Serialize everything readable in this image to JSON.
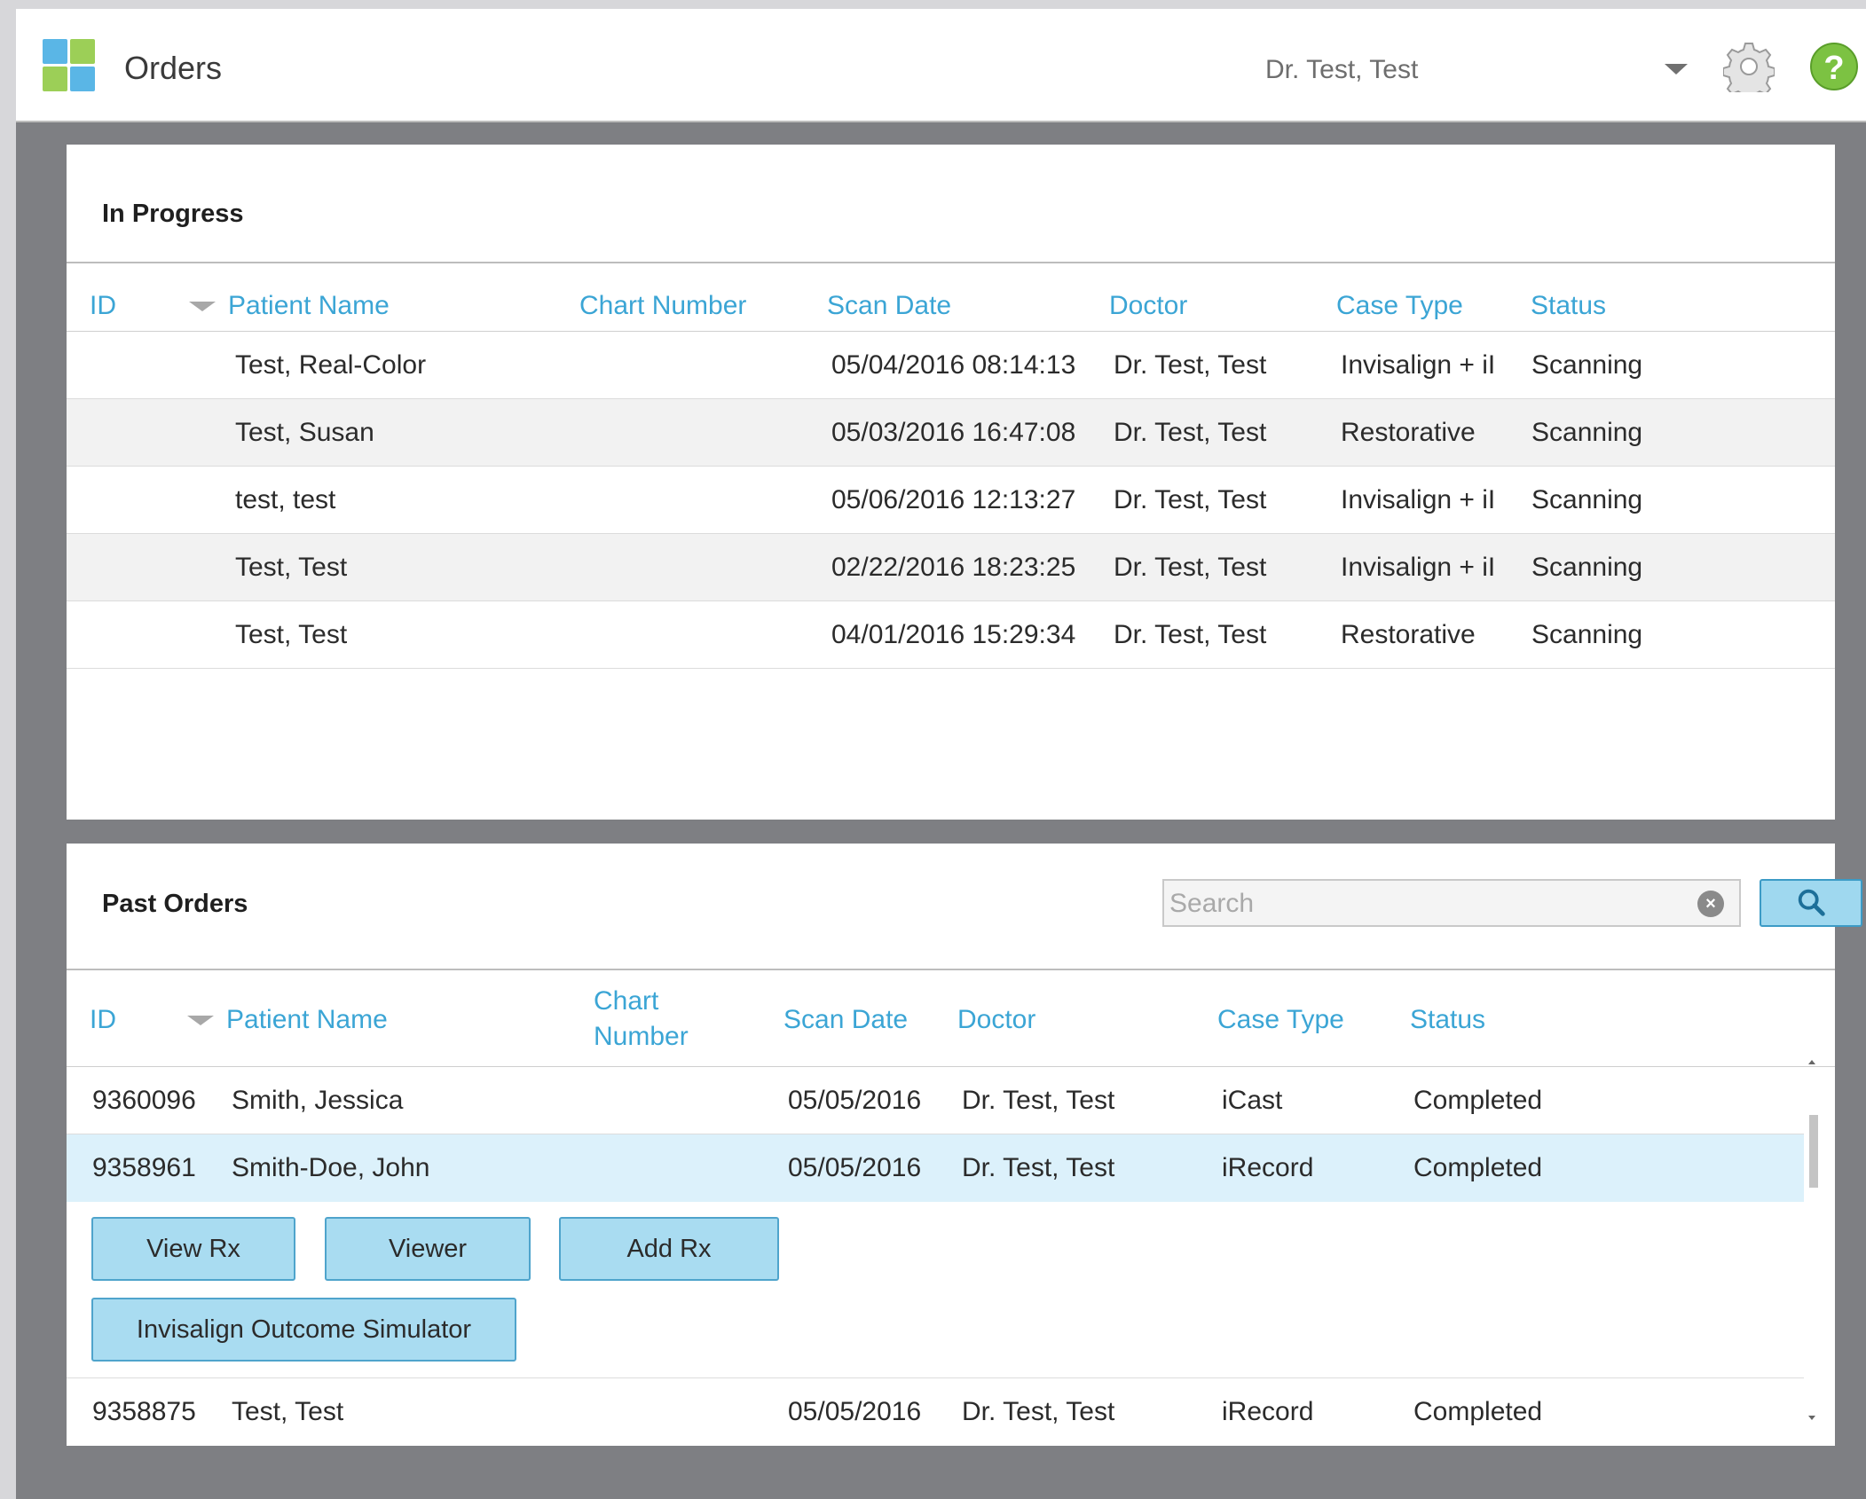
{
  "header": {
    "title": "Orders",
    "doctor": "Dr. Test, Test",
    "help_glyph": "?",
    "icons": [
      "app-logo-icon",
      "chevron-down-icon",
      "gear-icon",
      "help-icon"
    ]
  },
  "in_progress": {
    "title": "In Progress",
    "columns": [
      "ID",
      "Patient Name",
      "Chart Number",
      "Scan Date",
      "Doctor",
      "Case Type",
      "Status"
    ],
    "rows": [
      {
        "id": "",
        "patient": "Test, Real-Color",
        "chart": "",
        "scan_date": "05/04/2016 08:14:13",
        "doctor": "Dr. Test, Test",
        "case_type": "Invisalign + iI",
        "status": "Scanning"
      },
      {
        "id": "",
        "patient": "Test, Susan",
        "chart": "",
        "scan_date": "05/03/2016 16:47:08",
        "doctor": "Dr. Test, Test",
        "case_type": "Restorative",
        "status": "Scanning"
      },
      {
        "id": "",
        "patient": "test, test",
        "chart": "",
        "scan_date": "05/06/2016 12:13:27",
        "doctor": "Dr. Test, Test",
        "case_type": "Invisalign + iI",
        "status": "Scanning"
      },
      {
        "id": "",
        "patient": "Test, Test",
        "chart": "",
        "scan_date": "02/22/2016 18:23:25",
        "doctor": "Dr. Test, Test",
        "case_type": "Invisalign + iI",
        "status": "Scanning"
      },
      {
        "id": "",
        "patient": "Test, Test",
        "chart": "",
        "scan_date": "04/01/2016 15:29:34",
        "doctor": "Dr. Test, Test",
        "case_type": "Restorative",
        "status": "Scanning"
      }
    ]
  },
  "past_orders": {
    "title": "Past Orders",
    "search_placeholder": "Search",
    "clear_glyph": "×",
    "columns": [
      "ID",
      "Patient Name",
      "Chart\nNumber",
      "Scan Date",
      "Doctor",
      "Case Type",
      "Status"
    ],
    "rows": [
      {
        "id": "9360096",
        "patient": "Smith, Jessica",
        "chart": "",
        "scan_date": "05/05/2016",
        "doctor": "Dr. Test, Test",
        "case_type": "iCast",
        "status": "Completed"
      },
      {
        "id": "9358961",
        "patient": "Smith-Doe, John",
        "chart": "",
        "scan_date": "05/05/2016",
        "doctor": "Dr. Test, Test",
        "case_type": "iRecord",
        "status": "Completed"
      },
      {
        "id": "9358875",
        "patient": "Test, Test",
        "chart": "",
        "scan_date": "05/05/2016",
        "doctor": "Dr. Test, Test",
        "case_type": "iRecord",
        "status": "Completed"
      }
    ],
    "actions": [
      "View Rx",
      "Viewer",
      "Add Rx",
      "Invisalign Outcome Simulator"
    ]
  },
  "colors": {
    "accent": "#3ba5d5",
    "button_fill": "#a9dcf1",
    "selected_row": "#dcf1fb",
    "help_green": "#7cc242",
    "background": "#7e7f83"
  }
}
